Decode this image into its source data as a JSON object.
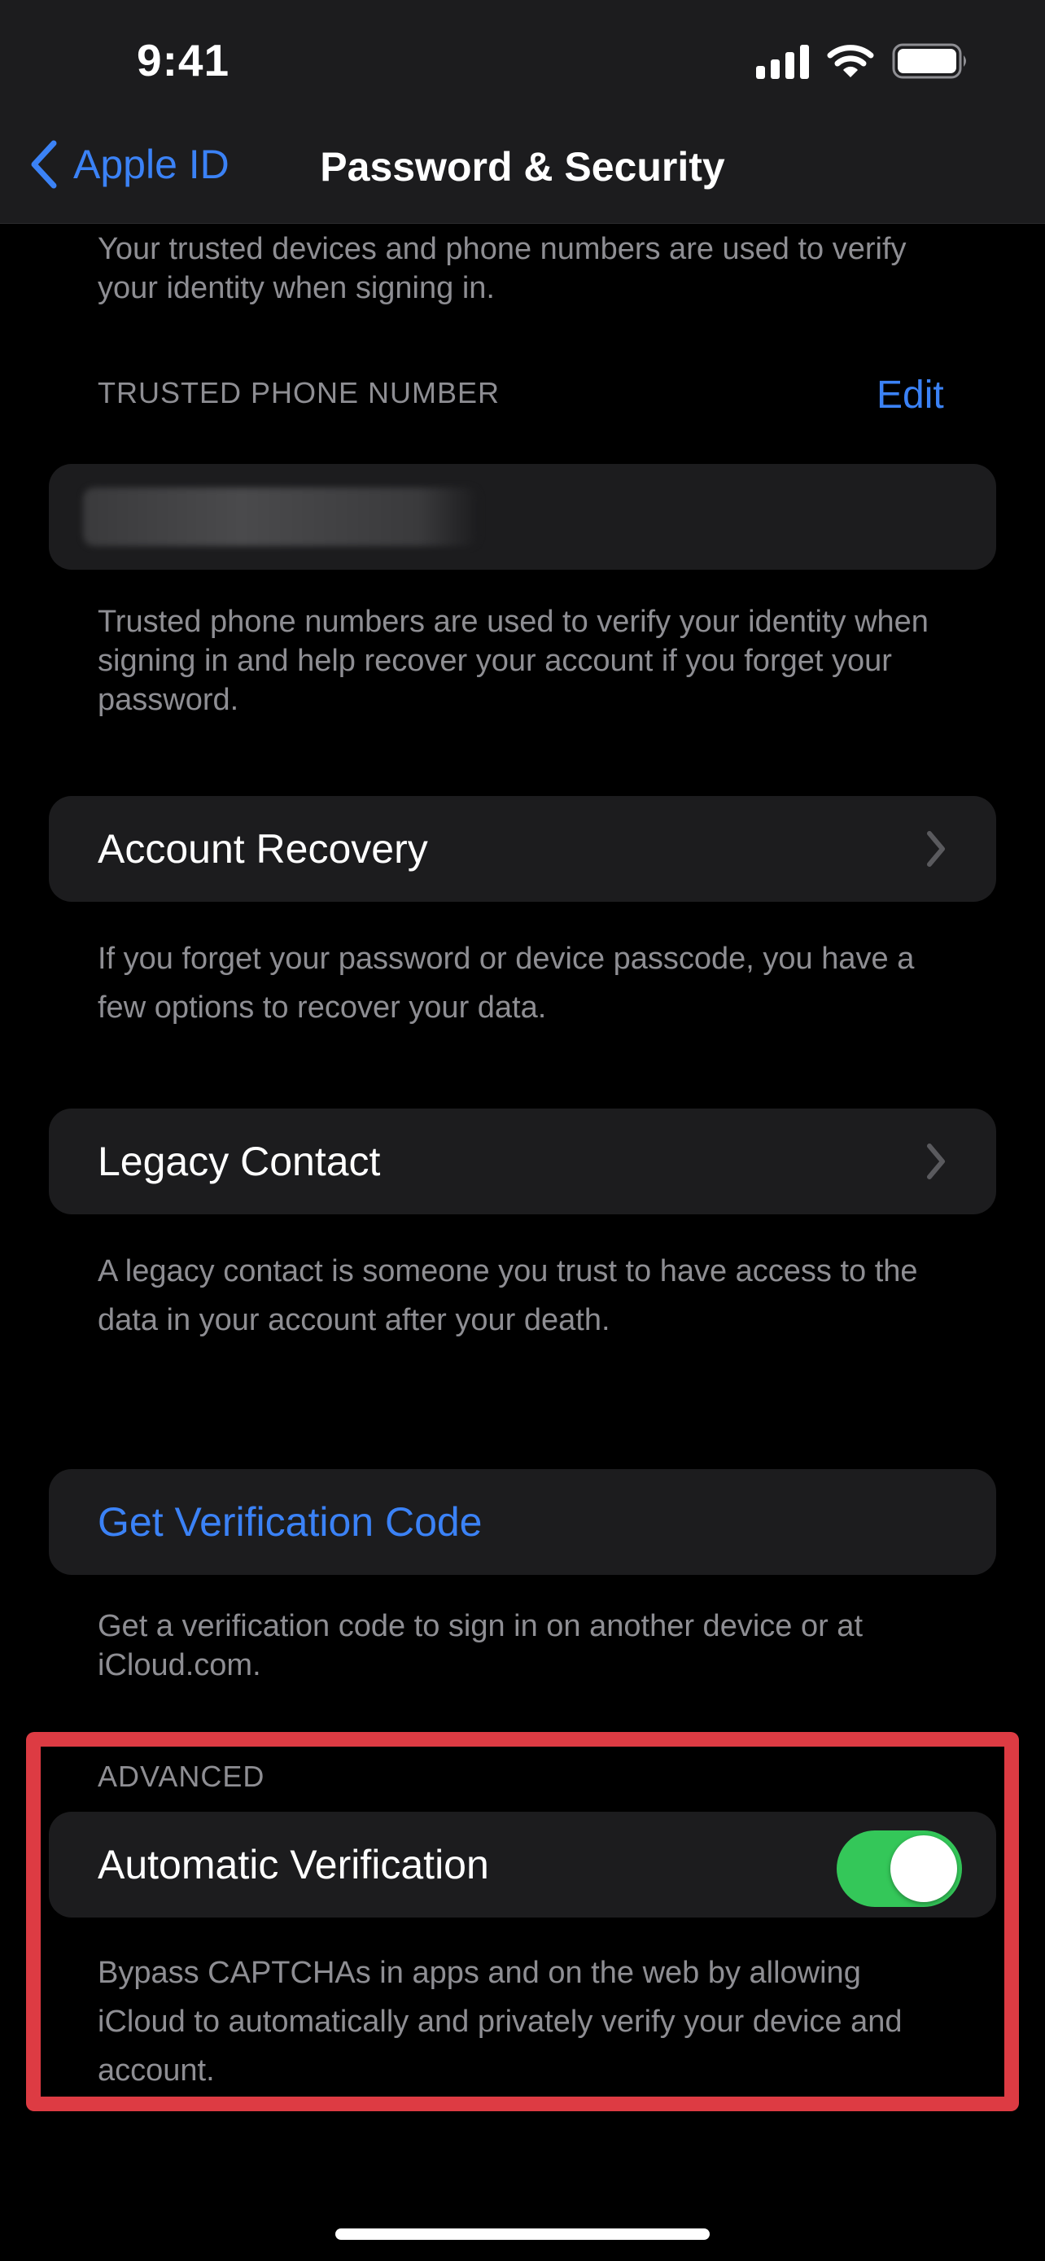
{
  "status_bar": {
    "time": "9:41"
  },
  "nav": {
    "back_label": "Apple ID",
    "title": "Password & Security"
  },
  "intro": {
    "text": "Your trusted devices and phone numbers are used to verify your identity when signing in."
  },
  "trusted_phone": {
    "header": "TRUSTED PHONE NUMBER",
    "edit_label": "Edit",
    "footer": "Trusted phone numbers are used to verify your identity when signing in and help recover your account if you forget your password."
  },
  "account_recovery": {
    "label": "Account Recovery",
    "footer": "If you forget your password or device passcode, you have a few options to recover your data."
  },
  "legacy_contact": {
    "label": "Legacy Contact",
    "footer": "A legacy contact is someone you trust to have access to the data in your account after your death."
  },
  "verification_code": {
    "label": "Get Verification Code",
    "footer": "Get a verification code to sign in on another device or at iCloud.com."
  },
  "advanced": {
    "header": "ADVANCED",
    "automatic_verification_label": "Automatic Verification",
    "automatic_verification_on": true,
    "footer": "Bypass CAPTCHAs in apps and on the web by allowing iCloud to automatically and privately verify your device and account."
  },
  "colors": {
    "accent": "#3b82f6",
    "toggle_on": "#34c759",
    "highlight": "#dd3b43",
    "cell_bg": "#1c1c1e",
    "secondary_text": "#8e8e93"
  }
}
